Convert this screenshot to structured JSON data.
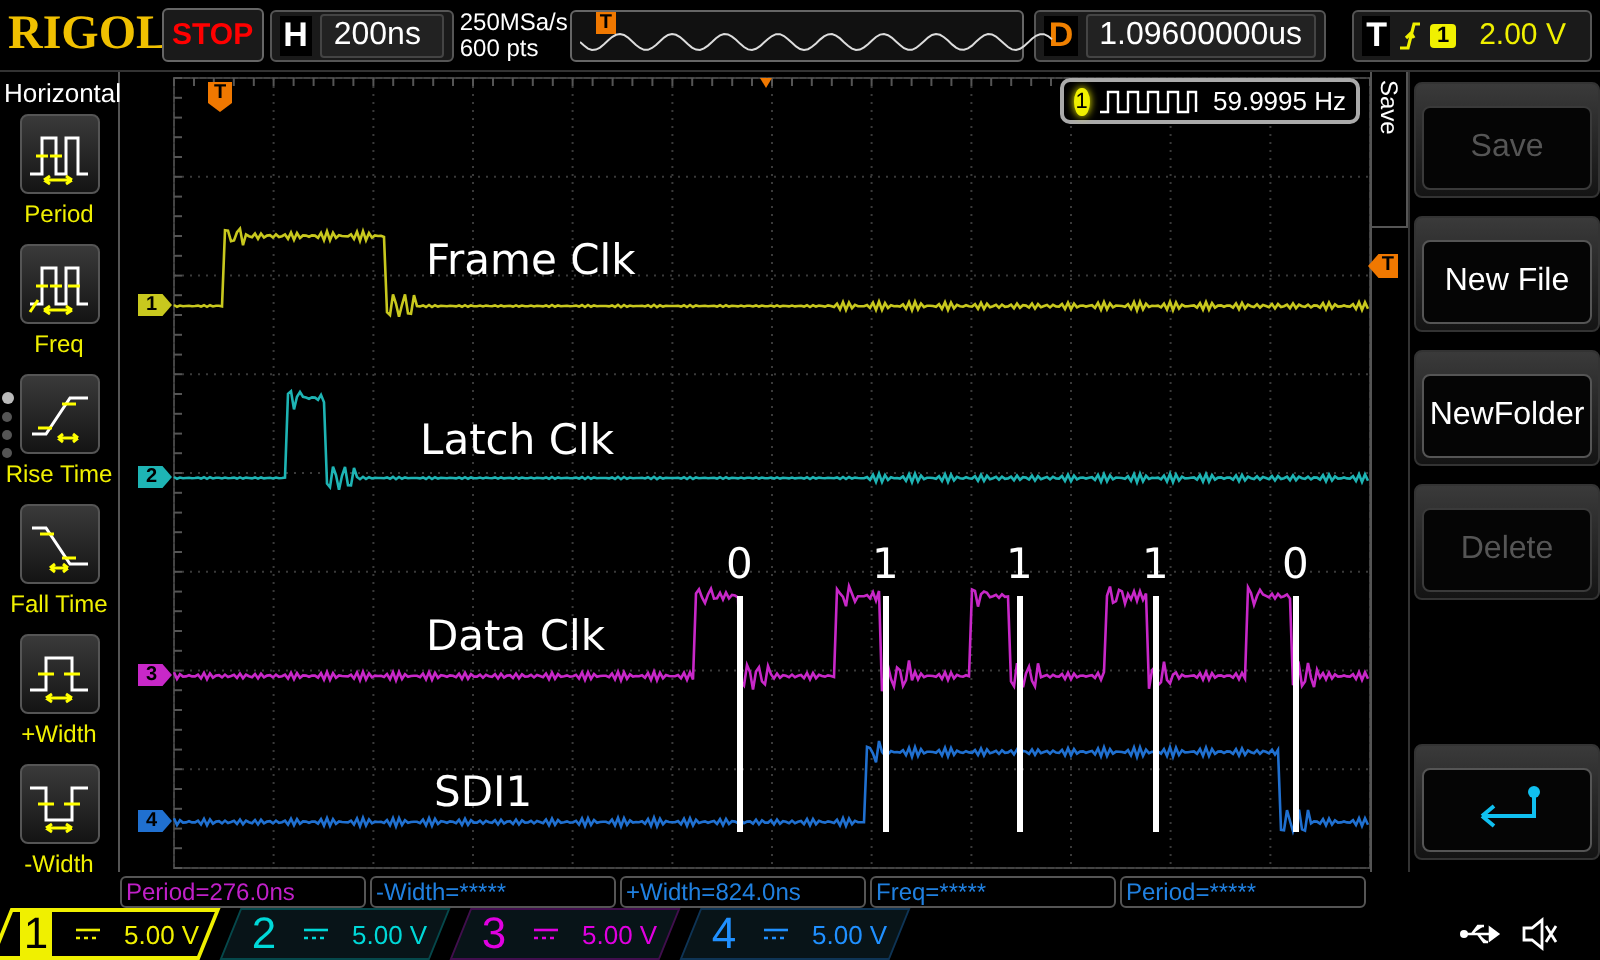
{
  "top_bar": {
    "logo": "RIGOL",
    "run_state": "STOP",
    "horizontal": {
      "label": "H",
      "value": "200ns"
    },
    "sample_rate": "250MSa/s",
    "memory_depth": "600 pts",
    "trigger_marker": "T",
    "delay": {
      "label": "D",
      "value": "1.09600000us"
    },
    "trigger": {
      "label": "T",
      "source": "1",
      "level": "2.00 V"
    }
  },
  "left_menu": {
    "title": "Horizontal",
    "items": [
      {
        "label": "Period",
        "kind": "period"
      },
      {
        "label": "Freq",
        "kind": "freq"
      },
      {
        "label": "Rise Time",
        "kind": "rise"
      },
      {
        "label": "Fall Time",
        "kind": "fall"
      },
      {
        "label": "+Width",
        "kind": "pwidth"
      },
      {
        "label": "-Width",
        "kind": "nwidth"
      }
    ],
    "pages": [
      {
        "selected": true
      },
      {
        "selected": false
      },
      {
        "selected": false
      },
      {
        "selected": false
      }
    ]
  },
  "screen": {
    "trigger_position_marker": "T",
    "trigger_level_marker": "T",
    "frequency_counter": {
      "channel": "1",
      "value": "59.9995 Hz"
    },
    "traces": [
      {
        "channel": "1",
        "label": "Frame Clk",
        "color": "#c8c81e"
      },
      {
        "channel": "2",
        "label": "Latch Clk",
        "color": "#1eb4b4"
      },
      {
        "channel": "3",
        "label": "Data Clk",
        "color": "#c828c8"
      },
      {
        "channel": "4",
        "label": "SDI1",
        "color": "#2070d0"
      }
    ],
    "bits": [
      "0",
      "1",
      "1",
      "1",
      "0"
    ]
  },
  "right_menu": {
    "title": "Save",
    "items": [
      {
        "kind": "button",
        "label": "Save",
        "disabled": true
      },
      {
        "kind": "button",
        "label": "New File",
        "disabled": false
      },
      {
        "kind": "button",
        "label": "NewFolder",
        "disabled": false
      },
      {
        "kind": "button",
        "label": "Delete",
        "disabled": true
      },
      {
        "kind": "back"
      }
    ]
  },
  "measurements": [
    {
      "text": "Period=276.0ns",
      "color": "#c020c8"
    },
    {
      "text": "-Width=*****",
      "color": "#2080e0"
    },
    {
      "text": "+Width=824.0ns",
      "color": "#2080e0"
    },
    {
      "text": "Freq=*****",
      "color": "#2080e0"
    },
    {
      "text": "Period=*****",
      "color": "#2080e0"
    }
  ],
  "channels": [
    {
      "number": "1",
      "scale": "5.00 V",
      "color": "#f0f000",
      "selected": true
    },
    {
      "number": "2",
      "scale": "5.00 V",
      "color": "#00d8d8",
      "selected": false
    },
    {
      "number": "3",
      "scale": "5.00 V",
      "color": "#e000e0",
      "selected": false
    },
    {
      "number": "4",
      "scale": "5.00 V",
      "color": "#2090ff",
      "selected": false
    }
  ]
}
